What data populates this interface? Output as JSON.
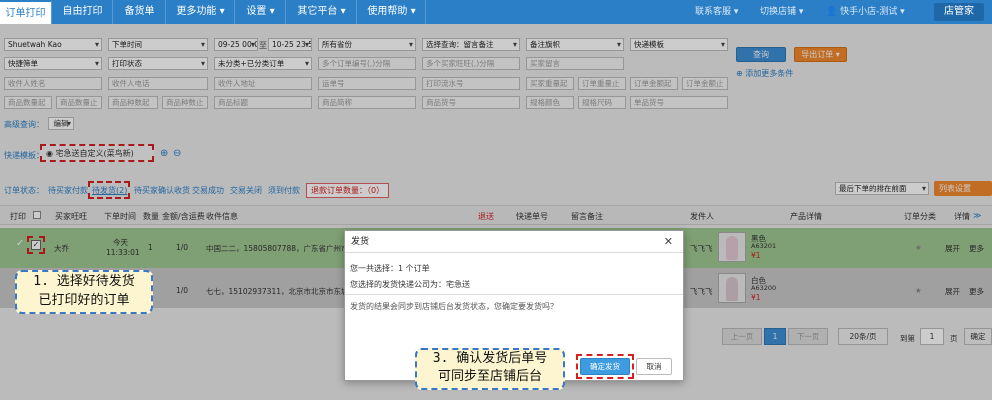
{
  "nav": {
    "tabs": [
      "订单打印",
      "自由打印",
      "备货单",
      "更多功能 ▾",
      "设置 ▾",
      "其它平台 ▾",
      "使用帮助 ▾"
    ],
    "right": [
      "联系客服 ▾",
      "切换店铺 ▾",
      "快手小店-测试 ▾"
    ],
    "logo": "店管家"
  },
  "filters": {
    "row1": [
      "Shuetwah Kao",
      "下单时间",
      "09-25 00:00",
      "至",
      "10-25 23:59",
      "所有省份",
      "选择查询：留言备注",
      "备注旗帜",
      "快递模板"
    ],
    "row2": [
      "快捷筛单",
      "打印状态",
      "未分类+已分类订单",
      "多个订单编号(,)分隔",
      "多个买家旺旺(,)分隔",
      "买家留言"
    ],
    "row3": [
      "收件人姓名",
      "收件人电话",
      "收件人地址",
      "运单号",
      "打印流水号",
      "买家重量起",
      "订单重量止",
      "订单金额起",
      "订单金额止"
    ],
    "row4": [
      "商品数量起",
      "商品数量止",
      "商品种数起",
      "商品种数止",
      "商品标题",
      "商品简称",
      "商品货号",
      "规格颜色",
      "规格尺码",
      "单品货号"
    ],
    "search_btn": "查询",
    "export_btn": "导出订单 ▾",
    "add_cond": "添加更多条件",
    "advanced_label": "高级查询：",
    "edit_btn": "编辑"
  },
  "express": {
    "label": "快递模板：",
    "selected": "宅急送自定义(菜鸟新)"
  },
  "status": {
    "label": "订单状态：",
    "tabs": [
      "待买家付款",
      "待发货(2)",
      "待买家确认收货",
      "交易成功",
      "交易关闭",
      "须到付款"
    ],
    "refund": "退款订单数量：（0）",
    "sort": "最后下单的排在前面",
    "list_settings": "列表设置"
  },
  "table": {
    "headers": [
      "打印",
      "买家旺旺",
      "下单时间",
      "数量",
      "金额/含运费",
      "收件信息",
      "退送",
      "快递单号",
      "留言备注",
      "发件人",
      "产品详情",
      "订单分类",
      "详情"
    ],
    "rows": [
      {
        "buyer": "大乔",
        "time1": "今天",
        "time2": "11:33:01",
        "qty": "1",
        "amount": "1/0",
        "addr": "中国二二，15805807788，广东省广州市荔湾...",
        "sender": "飞飞飞",
        "prod1": "黑色",
        "prod2": "A63201",
        "prod3": "¥1",
        "detail": "展开",
        "more": "更多"
      },
      {
        "buyer": "",
        "time1": "",
        "time2": "",
        "qty": "1",
        "amount": "1/0",
        "addr": "七七，15102937311，北京市北京市东城区...",
        "sender": "飞飞飞",
        "prod1": "白色",
        "prod2": "A63200",
        "prod3": "¥1",
        "detail": "展开",
        "more": "更多"
      }
    ]
  },
  "pager": {
    "prev": "上一页",
    "page": "1",
    "next": "下一页",
    "per_page": "20条/页",
    "goto": "到第",
    "goto_val": "1",
    "page_unit": "页",
    "confirm": "确定"
  },
  "modal": {
    "title": "发货",
    "line1": "您一共选择：1 个订单",
    "line2": "您选择的发货快递公司为：宅急送",
    "line3": "发货的结果会同步到店铺后台发货状态，您确定要发货吗？",
    "confirm": "确定发货",
    "cancel": "取消"
  },
  "callouts": {
    "step1_l1": "1. 选择好待发货",
    "step1_l2": "已打印好的订单",
    "step3_l1": "3. 确认发货后单号",
    "step3_l2": "可同步至店铺后台"
  }
}
